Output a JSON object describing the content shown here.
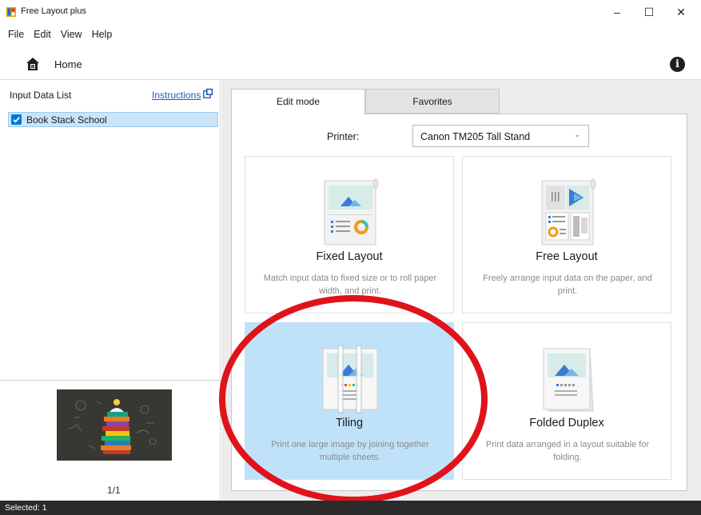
{
  "window": {
    "title": "Free Layout plus",
    "minimize_glyph": "–",
    "maximize_glyph": "☐",
    "close_glyph": "✕"
  },
  "menu": {
    "items": [
      {
        "name": "menu-file",
        "label": "File"
      },
      {
        "name": "menu-edit",
        "label": "Edit"
      },
      {
        "name": "menu-view",
        "label": "View"
      },
      {
        "name": "menu-help",
        "label": "Help"
      }
    ]
  },
  "homebar": {
    "home_label": "Home",
    "info_glyph": "i"
  },
  "left_panel": {
    "header": "Input Data List",
    "instructions_label": "Instructions",
    "items": [
      {
        "label": "Book Stack School",
        "checked": true
      }
    ],
    "page_count": "1/1"
  },
  "tabs": {
    "edit_mode": "Edit mode",
    "favorites": "Favorites"
  },
  "printer": {
    "label": "Printer:",
    "selected": "Canon TM205 Tall Stand"
  },
  "cards": {
    "fixed": {
      "title": "Fixed Layout",
      "desc": "Match input data to fixed size or to roll paper width, and print."
    },
    "free": {
      "title": "Free Layout",
      "desc": "Freely arrange input data on the paper, and print."
    },
    "tiling": {
      "title": "Tiling",
      "desc": "Print one large image by joining together multiple sheets."
    },
    "folded": {
      "title": "Folded Duplex",
      "desc": "Print data arranged in a layout suitable for folding."
    }
  },
  "status": {
    "text": "Selected: 1"
  },
  "colors": {
    "selected_card": "#c0e2f8",
    "list_selection": "#cce4f7",
    "accent": "#0078d7",
    "annotation": "#e0131b"
  }
}
